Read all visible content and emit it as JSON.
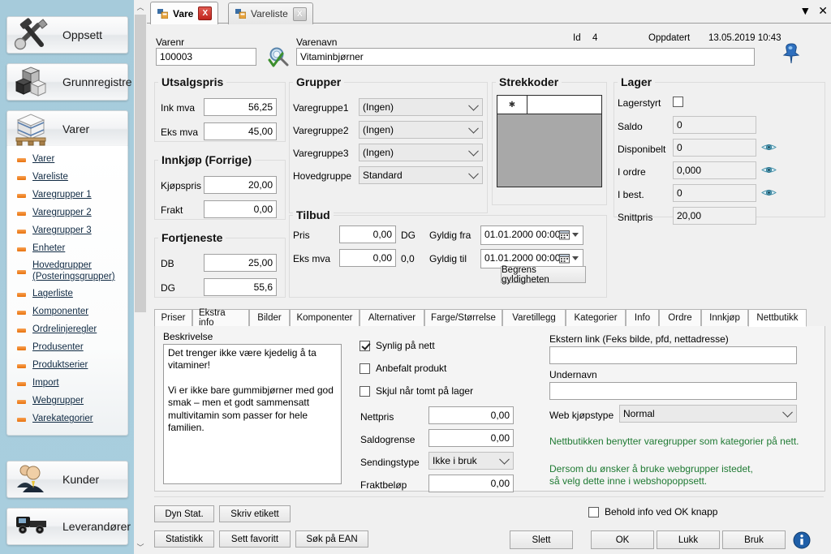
{
  "sidebar": {
    "nav": [
      {
        "label": "Oppsett",
        "icon": "tools-icon"
      },
      {
        "label": "Grunnregistre",
        "icon": "boxes-icon"
      },
      {
        "label": "Varer",
        "icon": "pallet-icon"
      },
      {
        "label": "Kunder",
        "icon": "people-icon"
      },
      {
        "label": "Leverandører",
        "icon": "truck-icon"
      }
    ],
    "submenu": [
      {
        "label": "Varer"
      },
      {
        "label": "Vareliste"
      },
      {
        "label": "Varegrupper 1"
      },
      {
        "label": "Varegrupper 2"
      },
      {
        "label": "Varegrupper 3"
      },
      {
        "label": "Enheter"
      },
      {
        "label": "Hovedgrupper (Posteringsgrupper)",
        "two_line": true
      },
      {
        "label": "Lagerliste"
      },
      {
        "label": "Komponenter"
      },
      {
        "label": "Ordrelinjeregler"
      },
      {
        "label": "Produsenter"
      },
      {
        "label": "Produktserier"
      },
      {
        "label": "Import"
      },
      {
        "label": "Webgrupper"
      },
      {
        "label": "Varekategorier"
      }
    ]
  },
  "window": {
    "tabs": [
      {
        "label": "Vare",
        "active": true,
        "close": "X"
      },
      {
        "label": "Vareliste",
        "active": false,
        "close": "X"
      }
    ],
    "minimize": "▼",
    "close": "✕"
  },
  "header": {
    "varenr_label": "Varenr",
    "varenr_value": "100003",
    "varenavn_label": "Varenavn",
    "varenavn_value": "Vitaminbjørner",
    "id_label": "Id",
    "id_value": "4",
    "oppdatert_label": "Oppdatert",
    "oppdatert_value": "13.05.2019 10:43",
    "search_icon": "magnifier-icon",
    "pin_icon": "pin-icon"
  },
  "utsalgspris": {
    "title": "Utsalgspris",
    "rows": [
      {
        "label": "Ink mva",
        "value": "56,25"
      },
      {
        "label": "Eks mva",
        "value": "45,00"
      }
    ]
  },
  "innkjop": {
    "title": "Innkjøp (Forrige)",
    "rows": [
      {
        "label": "Kjøpspris",
        "value": "20,00"
      },
      {
        "label": "Frakt",
        "value": "0,00"
      }
    ]
  },
  "fortjeneste": {
    "title": "Fortjeneste",
    "rows": [
      {
        "label": "DB",
        "value": "25,00"
      },
      {
        "label": "DG",
        "value": "55,6"
      }
    ]
  },
  "grupper": {
    "title": "Grupper",
    "rows": [
      {
        "label": "Varegruppe1",
        "value": "(Ingen)"
      },
      {
        "label": "Varegruppe2",
        "value": "(Ingen)"
      },
      {
        "label": "Varegruppe3",
        "value": "(Ingen)"
      },
      {
        "label": "Hovedgruppe",
        "value": "Standard"
      }
    ]
  },
  "tilbud": {
    "title": "Tilbud",
    "pris_label": "Pris",
    "pris_value": "0,00",
    "dg_label": "DG",
    "eksmva_label": "Eks mva",
    "eksmva_value": "0,00",
    "dg_value": "0,0",
    "gyldig_fra_label": "Gyldig fra",
    "gyldig_fra_value": "01.01.2000 00:00",
    "gyldig_til_label": "Gyldig til",
    "gyldig_til_value": "01.01.2000 00:00",
    "begrens_button": "Begrens gyldigheten"
  },
  "strekkoder": {
    "title": "Strekkoder",
    "new_row_marker": "✱"
  },
  "lager": {
    "title": "Lager",
    "lagerstyrt_label": "Lagerstyrt",
    "lagerstyrt_checked": false,
    "rows": [
      {
        "label": "Saldo",
        "value": "0",
        "eye": false
      },
      {
        "label": "Disponibelt",
        "value": "0",
        "eye": true
      },
      {
        "label": "I ordre",
        "value": "0,000",
        "eye": true
      },
      {
        "label": "I best.",
        "value": "0",
        "eye": true
      },
      {
        "label": "Snittpris",
        "value": "20,00",
        "eye": false
      }
    ]
  },
  "lower_tabs": [
    {
      "label": "Priser",
      "active": false
    },
    {
      "label": "Ekstra info",
      "active": false
    },
    {
      "label": "Bilder",
      "active": false
    },
    {
      "label": "Komponenter",
      "active": false
    },
    {
      "label": "Alternativer",
      "active": false
    },
    {
      "label": "Farge/Størrelse",
      "active": false
    },
    {
      "label": "Varetillegg",
      "active": false
    },
    {
      "label": "Kategorier",
      "active": false
    },
    {
      "label": "Info",
      "active": false
    },
    {
      "label": "Ordre",
      "active": false
    },
    {
      "label": "Innkjøp",
      "active": false
    },
    {
      "label": "Nettbutikk",
      "active": true
    }
  ],
  "nettbutikk": {
    "beskrivelse_label": "Beskrivelse",
    "beskrivelse_value": "Det trenger ikke være kjedelig å ta vitaminer!\n\nVi er ikke bare gummibjørner med god smak – men et godt sammensatt multivitamin som passer for hele familien.",
    "checkboxes": [
      {
        "label": "Synlig på nett",
        "checked": true
      },
      {
        "label": "Anbefalt produkt",
        "checked": false
      },
      {
        "label": "Skjul når tomt på lager",
        "checked": false
      }
    ],
    "fields": [
      {
        "label": "Nettpris",
        "value": "0,00"
      },
      {
        "label": "Saldogrense",
        "value": "0,00"
      }
    ],
    "sendingstype_label": "Sendingstype",
    "sendingstype_value": "Ikke i bruk",
    "fraktbelop_label": "Fraktbeløp",
    "fraktbelop_value": "0,00",
    "ekstern_link_label": "Ekstern link (Feks bilde, pfd, nettadresse)",
    "ekstern_link_value": "",
    "undernavn_label": "Undernavn",
    "undernavn_value": "",
    "web_kjopstype_label": "Web kjøpstype",
    "web_kjopstype_value": "Normal",
    "note1": "Nettbutikken benytter varegrupper som kategorier på nett.",
    "note2_line1": "Dersom du ønsker å bruke webgrupper istedet,",
    "note2_line2": "så velg dette inne i webshopoppsett."
  },
  "footer": {
    "left_row1": [
      {
        "label": "Dyn Stat."
      },
      {
        "label": "Skriv etikett"
      }
    ],
    "left_row2": [
      {
        "label": "Statistikk"
      },
      {
        "label": "Sett favoritt"
      },
      {
        "label": "Søk på EAN"
      }
    ],
    "keep_info_label": "Behold info ved OK knapp",
    "keep_info_checked": false,
    "right": [
      {
        "label": "Slett"
      },
      {
        "label": "OK"
      },
      {
        "label": "Lukk"
      },
      {
        "label": "Bruk"
      }
    ],
    "info_icon": "info-icon"
  },
  "colors": {
    "sidebar_bg": "#a8cddc",
    "accent_orange": "#ef7c12",
    "green_note": "#1f7a33",
    "info_blue": "#1f5fa8",
    "close_red": "#c0241c"
  }
}
